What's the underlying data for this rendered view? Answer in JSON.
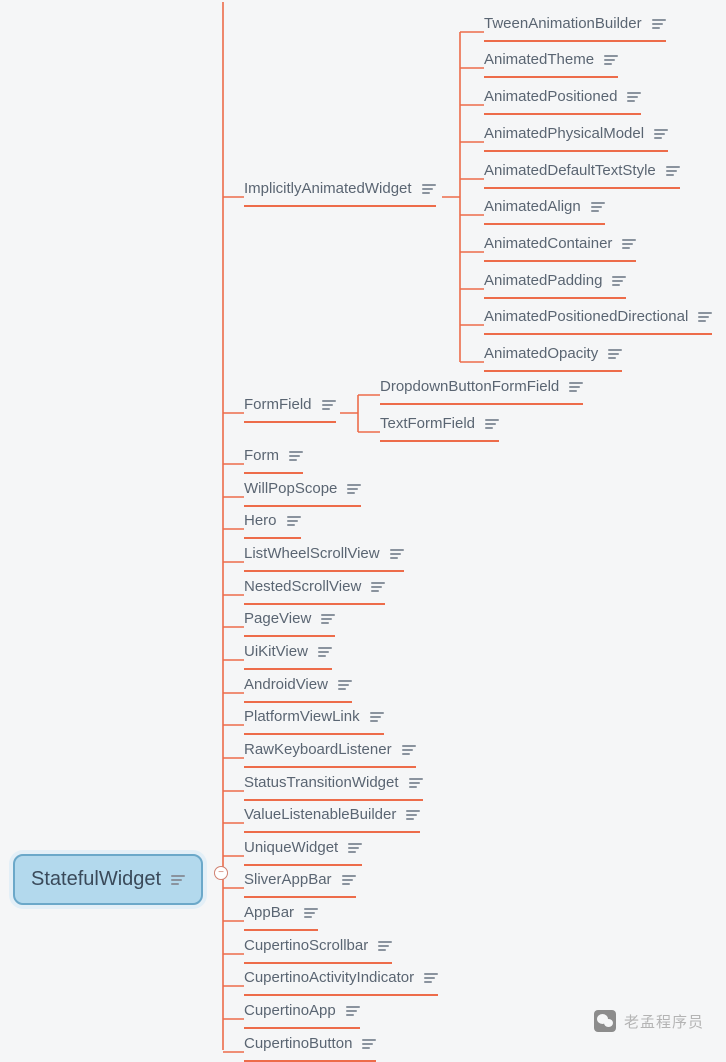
{
  "root": {
    "label": "StatefulWidget"
  },
  "level1": {
    "implicitly": {
      "label": "ImplicitlyAnimatedWidget"
    },
    "formfield": {
      "label": "FormField"
    },
    "items": [
      {
        "label": "Form"
      },
      {
        "label": "WillPopScope"
      },
      {
        "label": "Hero"
      },
      {
        "label": "ListWheelScrollView"
      },
      {
        "label": "NestedScrollView"
      },
      {
        "label": "PageView"
      },
      {
        "label": "UiKitView"
      },
      {
        "label": "AndroidView"
      },
      {
        "label": "PlatformViewLink"
      },
      {
        "label": "RawKeyboardListener"
      },
      {
        "label": "StatusTransitionWidget"
      },
      {
        "label": "ValueListenableBuilder"
      },
      {
        "label": "UniqueWidget"
      },
      {
        "label": "SliverAppBar"
      },
      {
        "label": "AppBar"
      },
      {
        "label": "CupertinoScrollbar"
      },
      {
        "label": "CupertinoActivityIndicator"
      },
      {
        "label": "CupertinoApp"
      },
      {
        "label": "CupertinoButton"
      }
    ]
  },
  "implicitChildren": [
    {
      "label": "TweenAnimationBuilder"
    },
    {
      "label": "AnimatedTheme"
    },
    {
      "label": "AnimatedPositioned"
    },
    {
      "label": "AnimatedPhysicalModel"
    },
    {
      "label": "AnimatedDefaultTextStyle"
    },
    {
      "label": "AnimatedAlign"
    },
    {
      "label": "AnimatedContainer"
    },
    {
      "label": "AnimatedPadding"
    },
    {
      "label": "AnimatedPositionedDirectional"
    },
    {
      "label": "AnimatedOpacity"
    }
  ],
  "formfieldChildren": [
    {
      "label": "DropdownButtonFormField"
    },
    {
      "label": "TextFormField"
    }
  ],
  "watermark": {
    "text": "老孟程序员"
  }
}
